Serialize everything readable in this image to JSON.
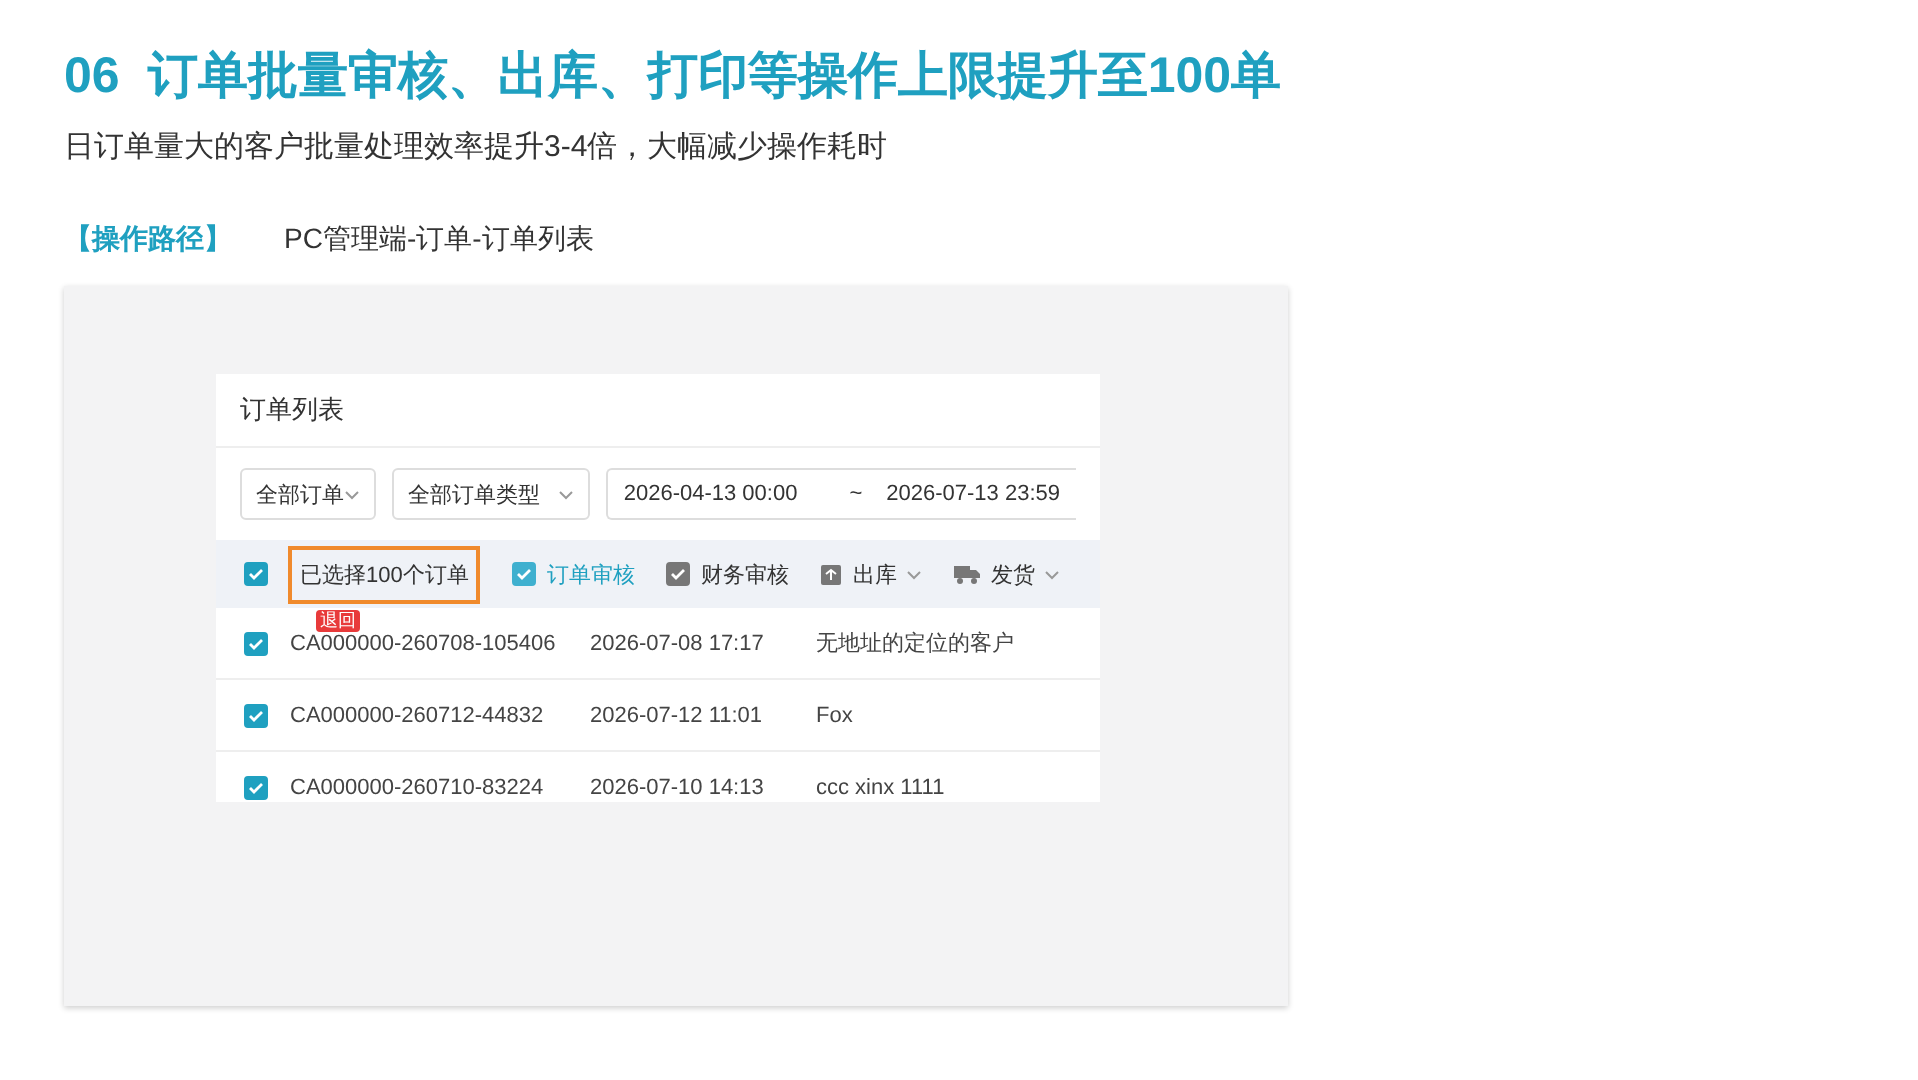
{
  "heading": {
    "number": "06",
    "title": "订单批量审核、出库、打印等操作上限提升至100单"
  },
  "subtitle": "日订单量大的客户批量处理效率提升3-4倍，大幅减少操作耗时",
  "path": {
    "label": "【操作路径】",
    "value": "PC管理端-订单-订单列表"
  },
  "panel": {
    "title": "订单列表",
    "filters": [
      {
        "kind": "select",
        "value": "全部订单"
      },
      {
        "kind": "select",
        "value": "全部订单类型"
      },
      {
        "kind": "range",
        "start": "2026-04-13 00:00",
        "separator": "~",
        "end": "2026-07-13 23:59"
      }
    ],
    "toolbar": {
      "checked": true,
      "selection": "已选择100个订单",
      "actions": [
        {
          "kind": "check",
          "label": "订单审核",
          "selected": true,
          "dropdown": false
        },
        {
          "kind": "check",
          "label": "财务审核",
          "selected": false,
          "dropdown": false
        },
        {
          "kind": "box",
          "label": "出库",
          "selected": false,
          "dropdown": true
        },
        {
          "kind": "truck",
          "label": "发货",
          "selected": false,
          "dropdown": true
        }
      ]
    },
    "rows": [
      {
        "checked": true,
        "tag": "退回",
        "order": "CA000000-260708-105406",
        "time": "2026-07-08 17:17",
        "customer": "无地址的定位的客户"
      },
      {
        "checked": true,
        "order": "CA000000-260712-44832",
        "time": "2026-07-12 11:01",
        "customer": "Fox"
      },
      {
        "checked": true,
        "order": "CA000000-260710-83224",
        "time": "2026-07-10 14:13",
        "customer": "ccc xinx 1111"
      }
    ]
  }
}
